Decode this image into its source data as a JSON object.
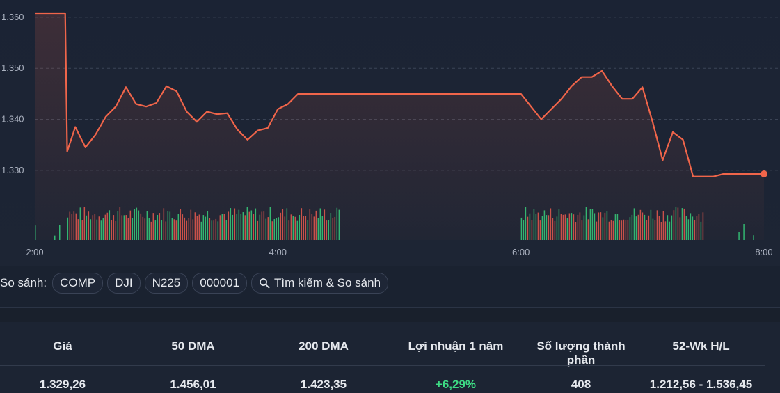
{
  "chart_data": {
    "type": "line",
    "series": [
      {
        "kind": "price",
        "x": [
          "2:00",
          "2:15",
          "2:16",
          "2:20",
          "2:25",
          "2:30",
          "2:35",
          "2:40",
          "2:45",
          "2:50",
          "2:55",
          "3:00",
          "3:05",
          "3:10",
          "3:15",
          "3:20",
          "3:25",
          "3:30",
          "3:35",
          "3:40",
          "3:45",
          "3:50",
          "3:55",
          "4:00",
          "4:05",
          "4:10",
          "4:15",
          "4:20",
          "4:25",
          "4:30",
          "4:35",
          "4:40",
          "4:45",
          "4:50",
          "4:55",
          "5:00",
          "5:30",
          "6:00",
          "6:05",
          "6:10",
          "6:15",
          "6:20",
          "6:25",
          "6:30",
          "6:35",
          "6:40",
          "6:45",
          "6:50",
          "6:55",
          "7:00",
          "7:05",
          "7:10",
          "7:15",
          "7:20",
          "7:25",
          "7:30",
          "7:35",
          "7:40",
          "7:45",
          "8:00"
        ],
        "y": [
          1360.8,
          1360.8,
          1333.7,
          1338.5,
          1334.5,
          1337.0,
          1340.5,
          1342.5,
          1346.3,
          1343.0,
          1342.5,
          1343.2,
          1346.5,
          1345.5,
          1341.5,
          1339.5,
          1341.5,
          1341.0,
          1341.2,
          1338.0,
          1336.0,
          1337.8,
          1338.3,
          1342.0,
          1343.0,
          1345.0,
          1345.0,
          1345.0,
          1345.0,
          1345.0,
          1345.0,
          1345.0,
          1345.0,
          1345.0,
          1345.0,
          1345.0,
          1345.0,
          1345.0,
          1342.5,
          1340.0,
          1342.0,
          1344.0,
          1346.5,
          1348.3,
          1348.3,
          1349.5,
          1346.5,
          1344.0,
          1344.0,
          1346.3,
          1339.5,
          1332.0,
          1337.5,
          1336.0,
          1328.8,
          1328.8,
          1328.8,
          1329.3,
          1329.3,
          1329.3
        ]
      }
    ],
    "volume_bars": [
      {
        "x_start": "2:00",
        "x_end": "2:15",
        "pattern": "sparse-green"
      },
      {
        "x_start": "2:16",
        "x_end": "4:30",
        "pattern": "dense-mixed"
      },
      {
        "x_start": "6:00",
        "x_end": "7:30",
        "pattern": "dense-mixed"
      },
      {
        "x_start": "7:45",
        "x_end": "8:00",
        "pattern": "sparse-green"
      }
    ],
    "x_ticks": [
      "2:00",
      "4:00",
      "6:00",
      "8:00"
    ],
    "y_ticks": [
      "1.330",
      "1.340",
      "1.350",
      "1.360"
    ],
    "ylim": [
      1326,
      1362
    ],
    "grid": true,
    "colors": {
      "line": "#f0654a",
      "volume_up": "#2eb872",
      "volume_down": "#c9514a",
      "grid": "#3b4456"
    }
  },
  "compare": {
    "label": "So sánh:",
    "chips": [
      "COMP",
      "DJI",
      "N225",
      "000001"
    ],
    "search_label": "Tìm kiếm & So sánh",
    "search_icon": "search-icon"
  },
  "stats": {
    "headers": [
      "Giá",
      "50 DMA",
      "200 DMA",
      "Lợi nhuận 1 năm",
      "Số lượng thành phần",
      "52-Wk H/L"
    ],
    "values": [
      "1.329,26",
      "1.456,01",
      "1.423,35",
      "+6,29%",
      "408",
      "1.212,56 - 1.536,45"
    ],
    "positive_color": "#3ddc84"
  }
}
